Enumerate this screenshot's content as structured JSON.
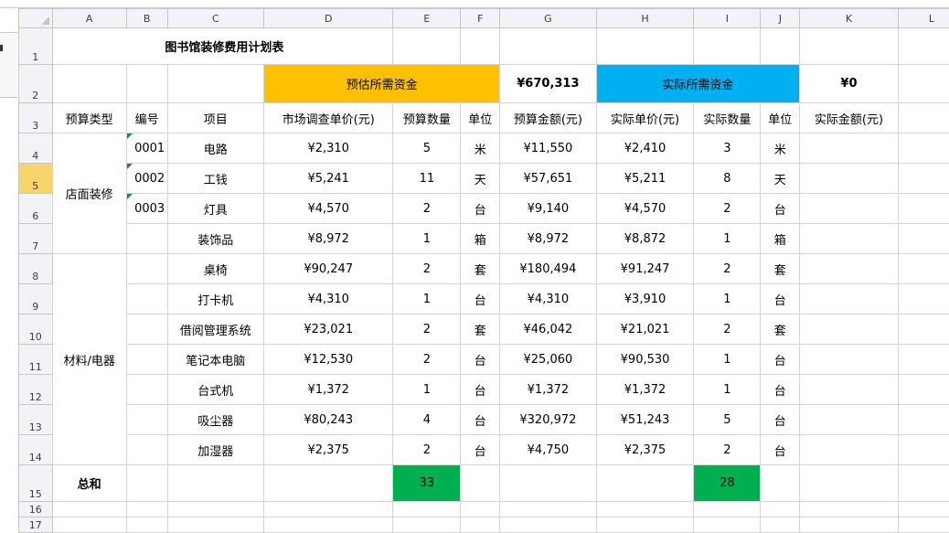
{
  "columns": [
    "A",
    "B",
    "C",
    "D",
    "E",
    "F",
    "G",
    "H",
    "I",
    "J",
    "K",
    "L"
  ],
  "title": "图书馆装修费用计划表",
  "row2": {
    "est_label": "预估所需资金",
    "est_total": "¥670,313",
    "actual_label": "实际所需资金",
    "actual_total": "¥0"
  },
  "headers": [
    "预算类型",
    "编号",
    "项目",
    "市场调查单价(元)",
    "预算数量",
    "单位",
    "预算金额(元)",
    "实际单价(元)",
    "实际数量",
    "单位",
    "实际金额(元)"
  ],
  "groups": [
    "店面装修",
    "材料/电器"
  ],
  "rows": [
    {
      "num": "4",
      "code": "0001",
      "item": "电路",
      "price": "¥2,310",
      "qty": "5",
      "unit": "米",
      "budget": "¥11,550",
      "aprice": "¥2,410",
      "aqty": "3",
      "aunit": "米"
    },
    {
      "num": "5",
      "code": "0002",
      "item": "工钱",
      "price": "¥5,241",
      "qty": "11",
      "unit": "天",
      "budget": "¥57,651",
      "aprice": "¥5,211",
      "aqty": "8",
      "aunit": "天"
    },
    {
      "num": "6",
      "code": "0003",
      "item": "灯具",
      "price": "¥4,570",
      "qty": "2",
      "unit": "台",
      "budget": "¥9,140",
      "aprice": "¥4,570",
      "aqty": "2",
      "aunit": "台"
    },
    {
      "num": "7",
      "code": "",
      "item": "装饰品",
      "price": "¥8,972",
      "qty": "1",
      "unit": "箱",
      "budget": "¥8,972",
      "aprice": "¥8,872",
      "aqty": "1",
      "aunit": "箱"
    },
    {
      "num": "8",
      "code": "",
      "item": "桌椅",
      "price": "¥90,247",
      "qty": "2",
      "unit": "套",
      "budget": "¥180,494",
      "aprice": "¥91,247",
      "aqty": "2",
      "aunit": "套"
    },
    {
      "num": "9",
      "code": "",
      "item": "打卡机",
      "price": "¥4,310",
      "qty": "1",
      "unit": "台",
      "budget": "¥4,310",
      "aprice": "¥3,910",
      "aqty": "1",
      "aunit": "台"
    },
    {
      "num": "10",
      "code": "",
      "item": "借阅管理系统",
      "price": "¥23,021",
      "qty": "2",
      "unit": "套",
      "budget": "¥46,042",
      "aprice": "¥21,021",
      "aqty": "2",
      "aunit": "套"
    },
    {
      "num": "11",
      "code": "",
      "item": "笔记本电脑",
      "price": "¥12,530",
      "qty": "2",
      "unit": "台",
      "budget": "¥25,060",
      "aprice": "¥90,530",
      "aqty": "1",
      "aunit": "台"
    },
    {
      "num": "12",
      "code": "",
      "item": "台式机",
      "price": "¥1,372",
      "qty": "1",
      "unit": "台",
      "budget": "¥1,372",
      "aprice": "¥1,372",
      "aqty": "1",
      "aunit": "台"
    },
    {
      "num": "13",
      "code": "",
      "item": "吸尘器",
      "price": "¥80,243",
      "qty": "4",
      "unit": "台",
      "budget": "¥320,972",
      "aprice": "¥51,243",
      "aqty": "5",
      "aunit": "台"
    },
    {
      "num": "14",
      "code": "",
      "item": "加湿器",
      "price": "¥2,375",
      "qty": "2",
      "unit": "台",
      "budget": "¥4,750",
      "aprice": "¥2,375",
      "aqty": "2",
      "aunit": "台"
    }
  ],
  "totals": {
    "label": "总和",
    "qty": "33",
    "aqty": "28"
  },
  "row_numbers": [
    "1",
    "2",
    "3",
    "15",
    "16",
    "17"
  ],
  "colors": {
    "est_fill": "#ffc000",
    "actual_fill": "#00b0f0",
    "total_fill": "#00b050",
    "selected_row_header": "#f8d46a"
  }
}
